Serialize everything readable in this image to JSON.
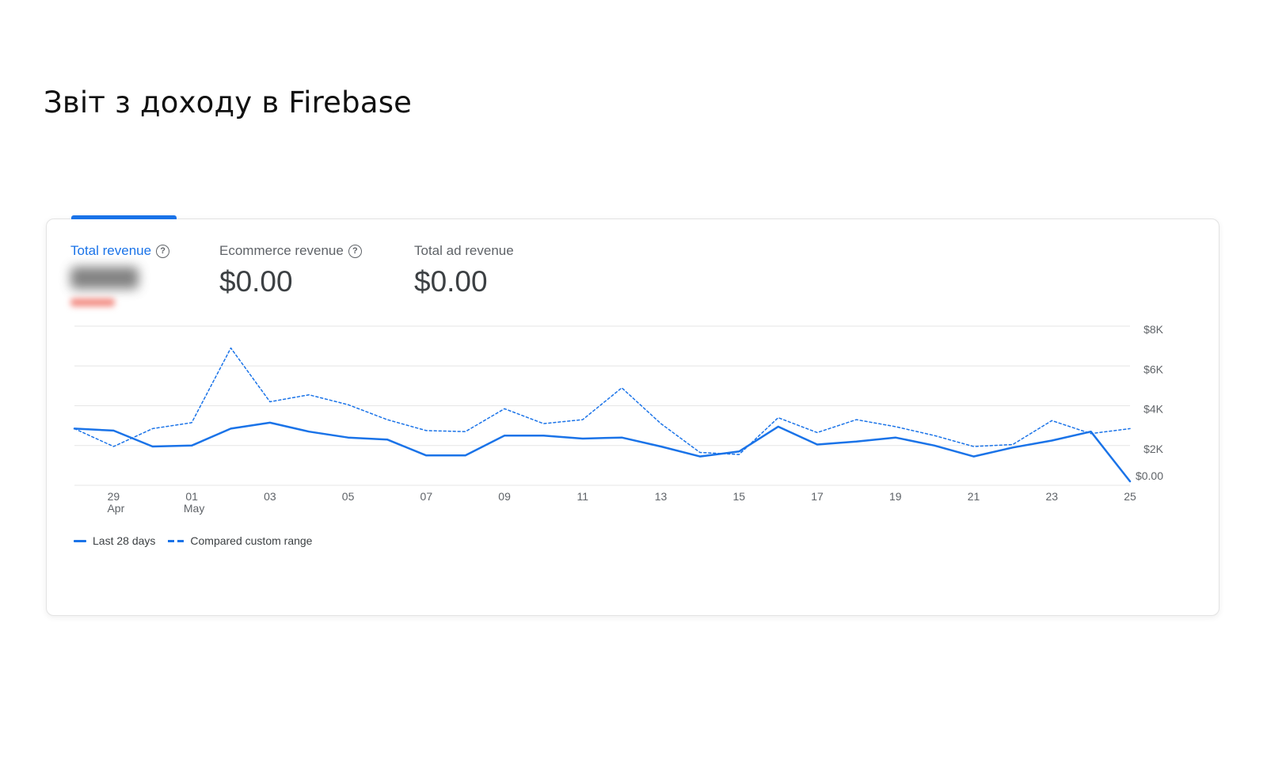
{
  "page": {
    "title": "Звіт з доходу в Firebase"
  },
  "metrics": [
    {
      "label": "Total revenue",
      "value": "",
      "help": true,
      "active": true,
      "value_blurred": true
    },
    {
      "label": "Ecommerce revenue",
      "value": "$0.00",
      "help": true,
      "active": false
    },
    {
      "label": "Total ad revenue",
      "value": "$0.00",
      "help": false,
      "active": false
    }
  ],
  "legend": {
    "current": "Last 28 days",
    "compare": "Compared custom range"
  },
  "colors": {
    "accent": "#1a73e8",
    "grid": "#e6e6e6",
    "axis_text": "#5f6368"
  },
  "chart_data": {
    "type": "line",
    "x": [
      "28 Apr",
      "29 Apr",
      "30 Apr",
      "01 May",
      "02 May",
      "03 May",
      "04 May",
      "05 May",
      "06 May",
      "07 May",
      "08 May",
      "09 May",
      "10 May",
      "11 May",
      "12 May",
      "13 May",
      "14 May",
      "15 May",
      "16 May",
      "17 May",
      "18 May",
      "19 May",
      "20 May",
      "21 May",
      "22 May",
      "23 May",
      "24 May",
      "25 May"
    ],
    "x_tick_labels": [
      {
        "index": 1,
        "label": "29",
        "sub": "Apr"
      },
      {
        "index": 3,
        "label": "01",
        "sub": "May"
      },
      {
        "index": 5,
        "label": "03"
      },
      {
        "index": 7,
        "label": "05"
      },
      {
        "index": 9,
        "label": "07"
      },
      {
        "index": 11,
        "label": "09"
      },
      {
        "index": 13,
        "label": "11"
      },
      {
        "index": 15,
        "label": "13"
      },
      {
        "index": 17,
        "label": "15"
      },
      {
        "index": 19,
        "label": "17"
      },
      {
        "index": 21,
        "label": "19"
      },
      {
        "index": 23,
        "label": "21"
      },
      {
        "index": 25,
        "label": "23"
      },
      {
        "index": 27,
        "label": "25"
      }
    ],
    "y_ticks": [
      {
        "value": 0,
        "label": "$0.00"
      },
      {
        "value": 2000,
        "label": "$2K"
      },
      {
        "value": 4000,
        "label": "$4K"
      },
      {
        "value": 6000,
        "label": "$6K"
      },
      {
        "value": 8000,
        "label": "$8K"
      }
    ],
    "ylim": [
      0,
      8000
    ],
    "grid": true,
    "legend_position": "bottom-left",
    "series": [
      {
        "name": "Last 28 days",
        "style": "solid",
        "values": [
          2850,
          2750,
          1950,
          2000,
          2850,
          3150,
          2700,
          2400,
          2300,
          1500,
          1500,
          2500,
          2500,
          2350,
          2400,
          1950,
          1450,
          1700,
          2950,
          2050,
          2200,
          2400,
          2000,
          1450,
          1900,
          2250,
          2700,
          200
        ]
      },
      {
        "name": "Compared custom range",
        "style": "dashed",
        "values": [
          2850,
          1950,
          2850,
          3150,
          6900,
          4200,
          4550,
          4050,
          3300,
          2750,
          2700,
          3850,
          3100,
          3300,
          4900,
          3100,
          1650,
          1550,
          3400,
          2650,
          3300,
          2950,
          2500,
          1950,
          2050,
          3250,
          2600,
          2850
        ]
      }
    ]
  }
}
